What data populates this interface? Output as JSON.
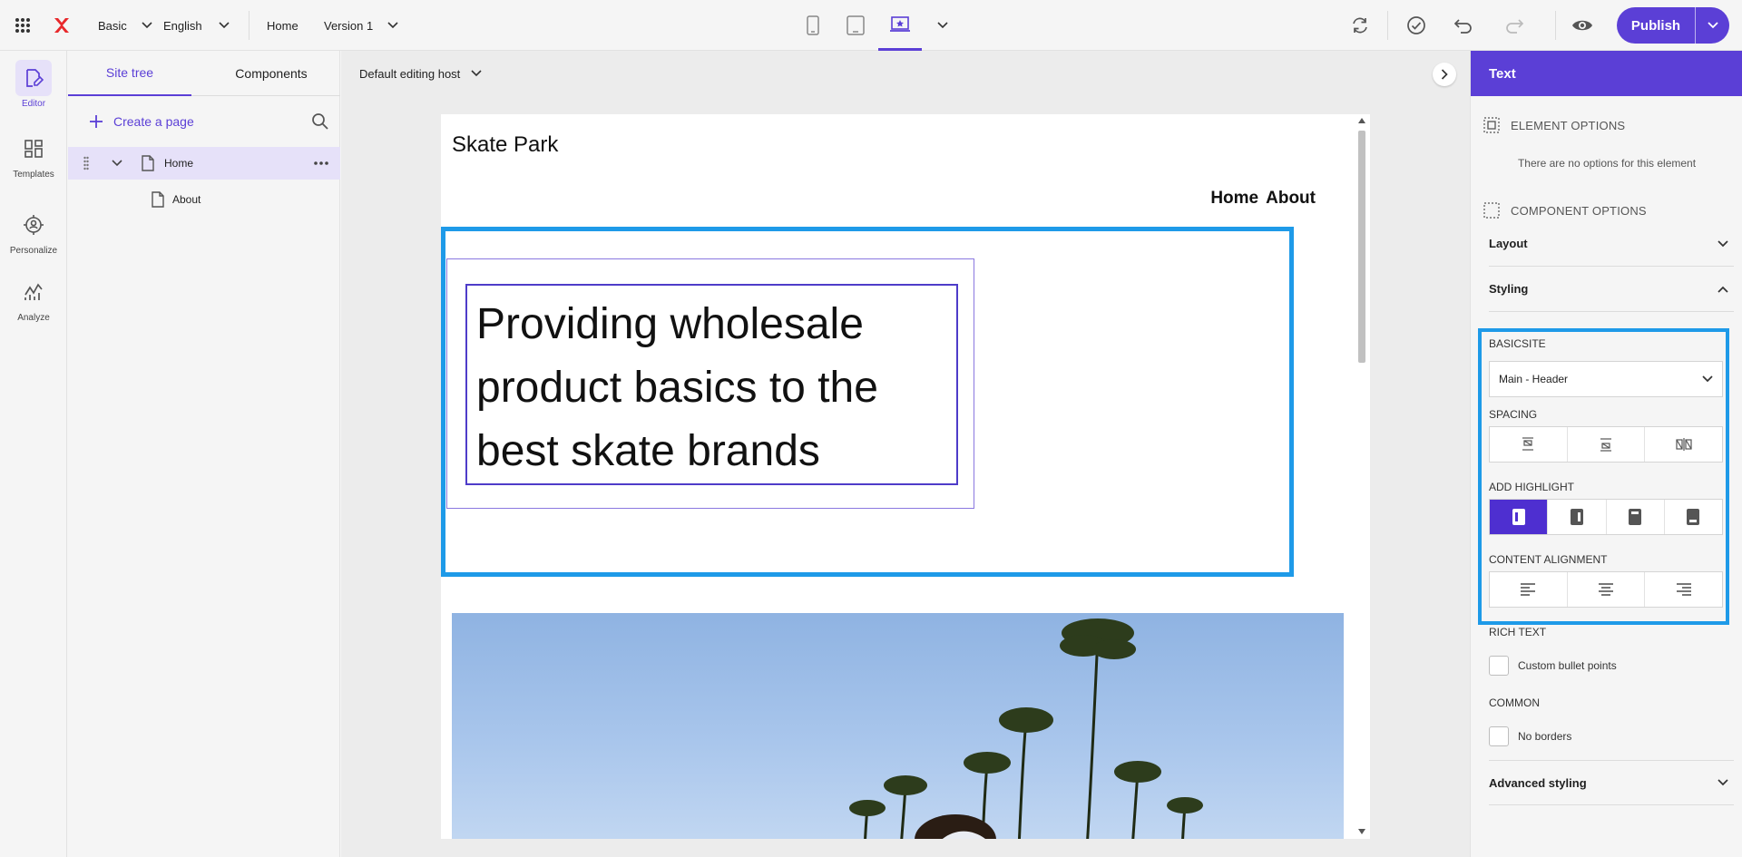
{
  "topbar": {
    "site_name": "Basic",
    "language": "English",
    "page": "Home",
    "version": "Version 1",
    "publish_label": "Publish"
  },
  "rail": {
    "items": [
      {
        "label": "Editor",
        "icon": "edit-page-icon"
      },
      {
        "label": "Templates",
        "icon": "templates-icon"
      },
      {
        "label": "Personalize",
        "icon": "personalize-icon"
      },
      {
        "label": "Analyze",
        "icon": "analyze-icon"
      }
    ]
  },
  "tree": {
    "tabs": [
      "Site tree",
      "Components"
    ],
    "create_label": "Create a page",
    "nodes": [
      {
        "label": "Home"
      },
      {
        "label": "About"
      }
    ]
  },
  "canvas": {
    "host_label": "Default editing host",
    "site_title": "Skate Park",
    "nav": [
      "Home",
      "About"
    ],
    "hero_text": "Providing wholesale product basics to the best skate brands"
  },
  "panel": {
    "title": "Text",
    "element_options": "ELEMENT OPTIONS",
    "element_empty": "There are no options for this element",
    "component_options": "COMPONENT OPTIONS",
    "layout": "Layout",
    "styling": "Styling",
    "basicsite_label": "BASICSITE",
    "basicsite_value": "Main - Header",
    "spacing_label": "SPACING",
    "highlight_label": "ADD HIGHLIGHT",
    "alignment_label": "CONTENT ALIGNMENT",
    "rich_text_label": "RICH TEXT",
    "custom_bullets": "Custom bullet points",
    "common_label": "COMMON",
    "no_borders": "No borders",
    "advanced": "Advanced styling"
  },
  "colors": {
    "accent": "#5b3fd6",
    "selection": "#1e9ae8",
    "highlight_active": "#4e2fd0"
  }
}
